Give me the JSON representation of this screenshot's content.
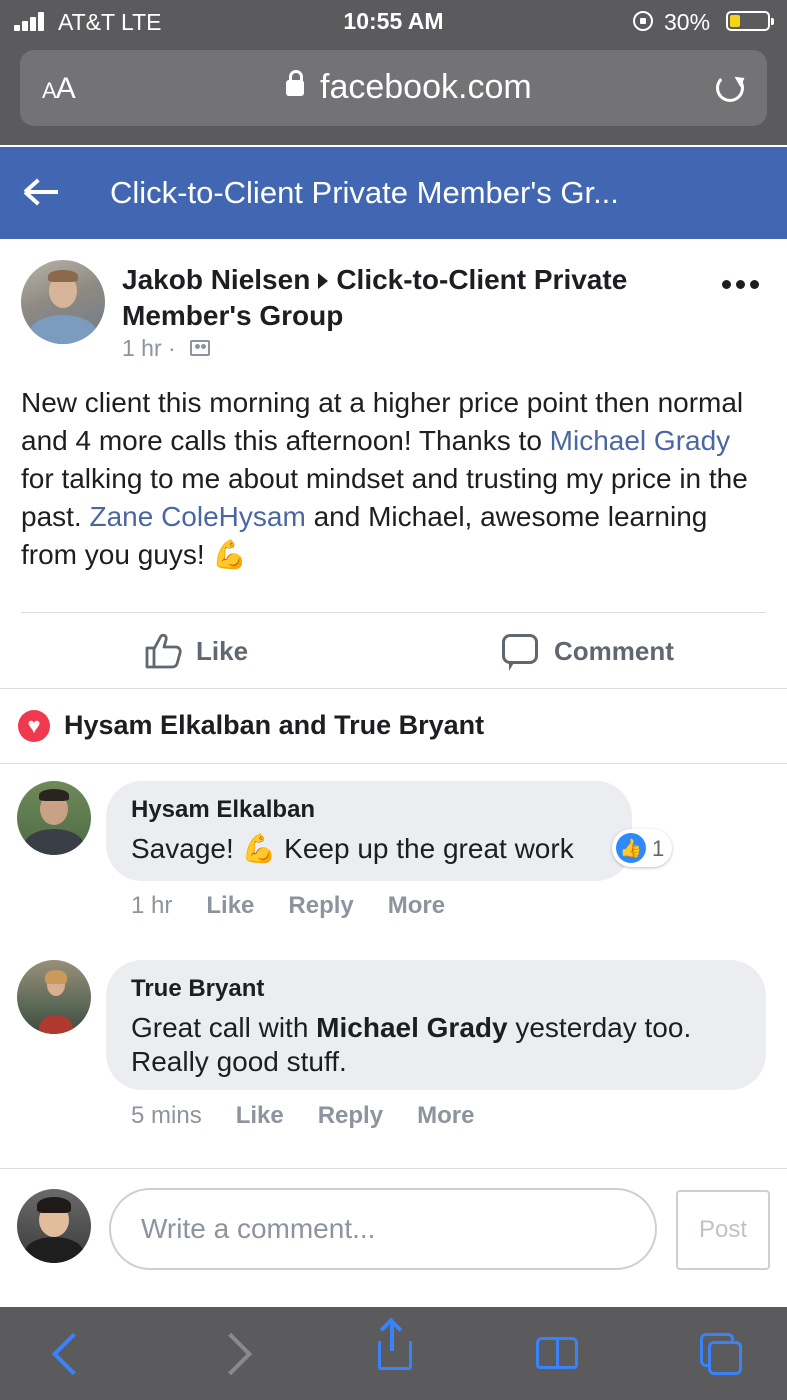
{
  "status_bar": {
    "carrier": "AT&T  LTE",
    "time": "10:55 AM",
    "battery": "30%"
  },
  "browser": {
    "text_size_label": "AA",
    "domain": "facebook.com"
  },
  "header": {
    "title": "Click-to-Client Private Member's Gr..."
  },
  "post": {
    "author": "Jakob Nielsen",
    "group": "Click-to-Client Private Member's Group",
    "time": "1 hr ·",
    "body_1": "New client this morning at a higher price point then normal and 4 more calls this afternoon! Thanks to ",
    "mention_1": "Michael Grady",
    "body_2": " for talking to me about mindset and trusting my price in the past. ",
    "mention_2": "Zane ColeHysam",
    "body_3": " and Michael, awesome learning from you guys! ",
    "emoji": "💪"
  },
  "actions": {
    "like": "Like",
    "comment": "Comment"
  },
  "reactions": {
    "names": "Hysam Elkalban and True Bryant"
  },
  "comments": [
    {
      "name": "Hysam Elkalban",
      "text_1": "Savage! ",
      "emoji": "💪",
      "text_2": " Keep up the great work",
      "like_count": "1",
      "time": "1 hr",
      "like": "Like",
      "reply": "Reply",
      "more": "More"
    },
    {
      "name": "True Bryant",
      "text_1": "Great call with ",
      "mention": "Michael Grady",
      "text_2": " yesterday too. Really good stuff.",
      "time": "5 mins",
      "like": "Like",
      "reply": "Reply",
      "more": "More"
    }
  ],
  "compose": {
    "placeholder": "Write a comment...",
    "post_label": "Post"
  },
  "colors": {
    "facebook_blue": "#4267b2",
    "link": "#4b67a1",
    "safari_blue": "#3a82f7"
  }
}
